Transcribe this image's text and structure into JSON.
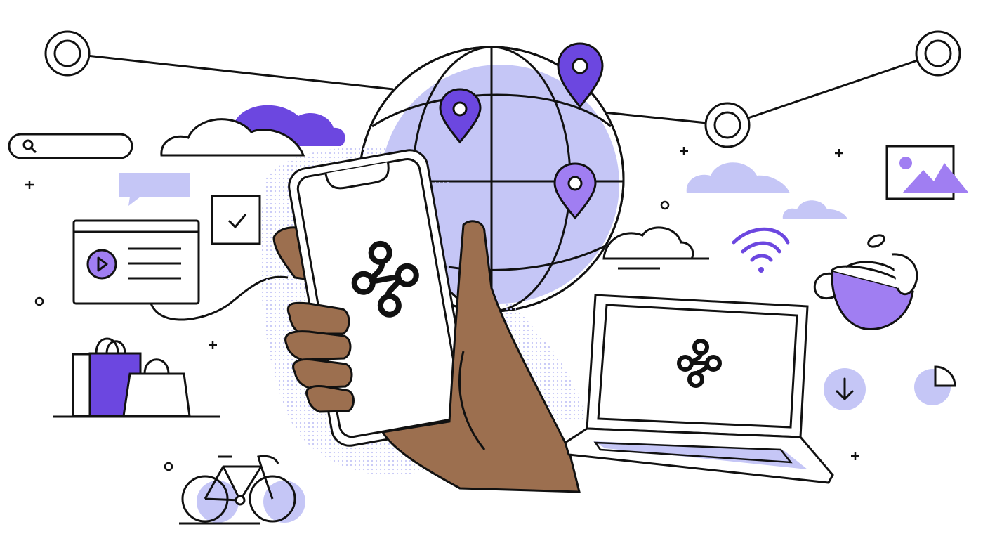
{
  "colors": {
    "ink": "#111111",
    "purple_dark": "#6c47e0",
    "purple_mid": "#a07ef2",
    "lavender": "#c5c6f6",
    "lavender_light": "#d7d8fa",
    "skin": "#9c6f4f",
    "white": "#ffffff"
  },
  "icons": {
    "search": "search-icon",
    "play": "play-icon",
    "check": "checkmark-icon",
    "wifi": "wifi-icon",
    "download": "download-arrow-icon",
    "pie": "pie-chart-icon",
    "image": "image-icon",
    "map_pin": "map-pin-icon",
    "app_logo": "connected-nodes-logo-icon"
  }
}
